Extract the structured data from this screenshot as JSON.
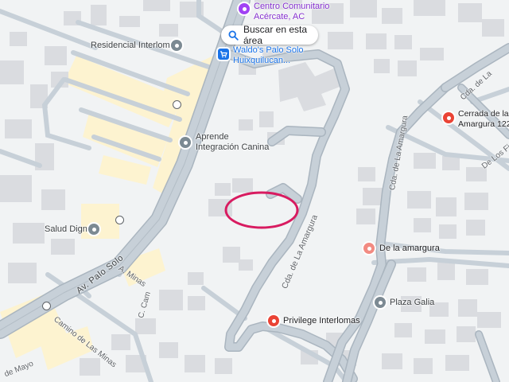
{
  "search_button": {
    "label": "Buscar en esta área",
    "icon": "search-icon"
  },
  "pois": [
    {
      "name": "Centro Comunitario",
      "name2": "Acércate, AC",
      "icon": "community-center-icon",
      "color": "#a142f4"
    },
    {
      "name": "Residencial Interlomas",
      "icon": "place-icon",
      "color": "#7c8a93"
    },
    {
      "name": "Waldo's Palo Solo",
      "name2": "Huixquilucan...",
      "icon": "shopping-cart-icon",
      "color": "#1a73e8"
    },
    {
      "name": "Aprende",
      "name2": "Integración Canina",
      "icon": "place-icon",
      "color": "#7c8a93"
    },
    {
      "name": "Cerrada de la",
      "name2": "Amargura 122",
      "icon": "place-icon",
      "color": "#ea4335"
    },
    {
      "name": "Salud Digna",
      "icon": "place-icon",
      "color": "#7c8a93"
    },
    {
      "name": "De la amargura",
      "icon": "place-icon",
      "color": "#f28b82"
    },
    {
      "name": "Plaza Galia",
      "icon": "place-icon",
      "color": "#7c8a93"
    },
    {
      "name": "Privilege Interlomas",
      "icon": "place-icon",
      "color": "#ea4335"
    }
  ],
  "streets": {
    "palo_solo": "Av. Palo Solo",
    "cda_amargura_center": "Cda. de La Amargura",
    "cda_amargura_right": "Cda. de La Amargura",
    "cda_de_la_ne": "Cda. de La",
    "de_los": "De Los Fi",
    "minas_lower": "Camino de Las Minas",
    "minas_upper": "A. Minas",
    "c_cam": "C. Cam",
    "de_mayo": "de Mayo"
  },
  "highlight": {
    "shape": "ellipse",
    "color": "#d81b60"
  },
  "colors": {
    "background": "#f1f3f4",
    "road": "#c7d0d8",
    "road_edge": "#aab5bf",
    "building": "#dadce0",
    "commercial": "#fdf3d0"
  }
}
